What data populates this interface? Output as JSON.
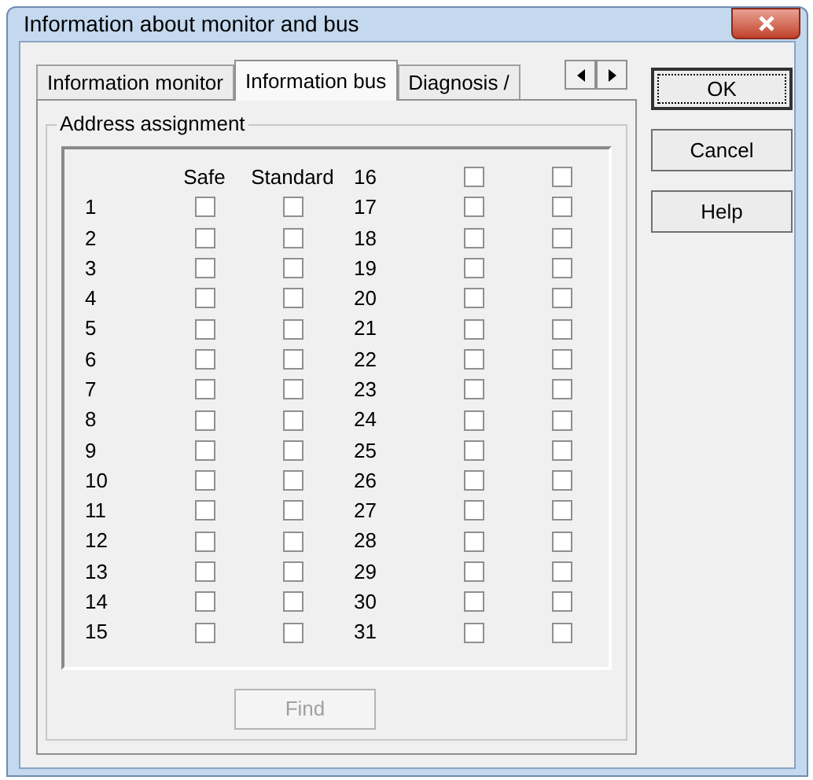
{
  "window": {
    "title": "Information about monitor and bus"
  },
  "tabs": [
    {
      "label": "Information monitor",
      "selected": false
    },
    {
      "label": "Information bus",
      "selected": true
    },
    {
      "label": "Diagnosis /",
      "selected": false
    }
  ],
  "group": {
    "title": "Address assignment",
    "columns": [
      "Safe",
      "Standard"
    ],
    "addresses": [
      {
        "address": "1",
        "safe": false,
        "standard": false
      },
      {
        "address": "2",
        "safe": false,
        "standard": false
      },
      {
        "address": "3",
        "safe": false,
        "standard": false
      },
      {
        "address": "4",
        "safe": false,
        "standard": false
      },
      {
        "address": "5",
        "safe": false,
        "standard": false
      },
      {
        "address": "6",
        "safe": false,
        "standard": false
      },
      {
        "address": "7",
        "safe": false,
        "standard": false
      },
      {
        "address": "8",
        "safe": false,
        "standard": false
      },
      {
        "address": "9",
        "safe": false,
        "standard": false
      },
      {
        "address": "10",
        "safe": false,
        "standard": false
      },
      {
        "address": "11",
        "safe": false,
        "standard": false
      },
      {
        "address": "12",
        "safe": false,
        "standard": false
      },
      {
        "address": "13",
        "safe": false,
        "standard": false
      },
      {
        "address": "14",
        "safe": false,
        "standard": false
      },
      {
        "address": "15",
        "safe": false,
        "standard": false
      },
      {
        "address": "16",
        "safe": false,
        "standard": false
      },
      {
        "address": "17",
        "safe": false,
        "standard": false
      },
      {
        "address": "18",
        "safe": false,
        "standard": false
      },
      {
        "address": "19",
        "safe": false,
        "standard": false
      },
      {
        "address": "20",
        "safe": false,
        "standard": false
      },
      {
        "address": "21",
        "safe": false,
        "standard": false
      },
      {
        "address": "22",
        "safe": false,
        "standard": false
      },
      {
        "address": "23",
        "safe": false,
        "standard": false
      },
      {
        "address": "24",
        "safe": false,
        "standard": false
      },
      {
        "address": "25",
        "safe": false,
        "standard": false
      },
      {
        "address": "26",
        "safe": false,
        "standard": false
      },
      {
        "address": "27",
        "safe": false,
        "standard": false
      },
      {
        "address": "28",
        "safe": false,
        "standard": false
      },
      {
        "address": "29",
        "safe": false,
        "standard": false
      },
      {
        "address": "30",
        "safe": false,
        "standard": false
      },
      {
        "address": "31",
        "safe": false,
        "standard": false
      }
    ],
    "find_button": {
      "label": "Find",
      "disabled": true
    }
  },
  "buttons": [
    {
      "label": "OK",
      "default": true
    },
    {
      "label": "Cancel",
      "default": false
    },
    {
      "label": "Help",
      "default": false
    }
  ]
}
